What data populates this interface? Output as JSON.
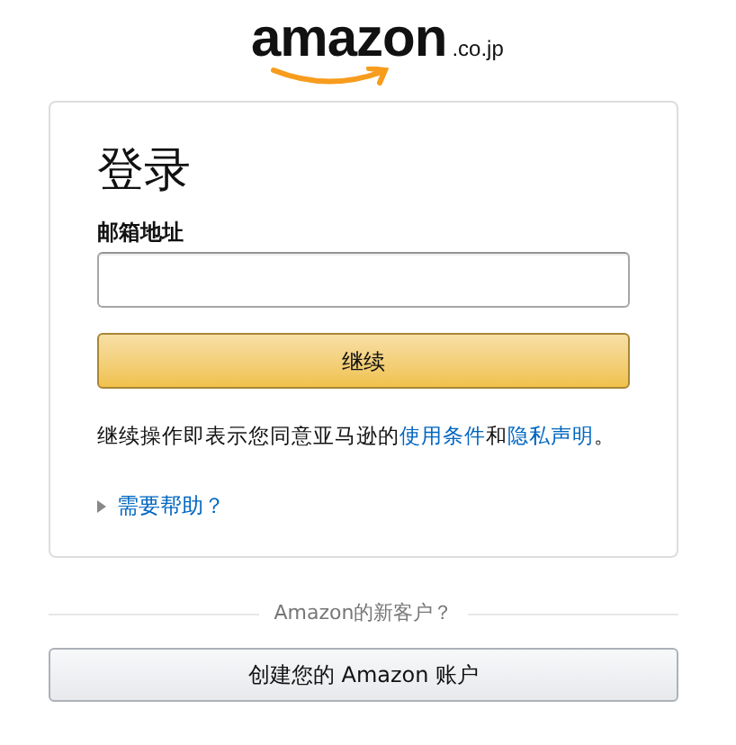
{
  "logo": {
    "wordmark": "amazon",
    "domain": ".co.jp"
  },
  "title": "登录",
  "email_field": {
    "label": "邮箱地址"
  },
  "continue_button": "继续",
  "legal": [
    {
      "kind": "text",
      "text": "继续操作即表示您同意亚马逊的"
    },
    {
      "kind": "link",
      "text": "使用条件"
    },
    {
      "kind": "text",
      "text": "和"
    },
    {
      "kind": "link",
      "text": "隐私声明"
    },
    {
      "kind": "text",
      "text": "。"
    }
  ],
  "help": {
    "label": "需要帮助？",
    "expanded": false
  },
  "divider_text": "Amazon的新客户？",
  "create_button": "创建您的 Amazon 账户"
}
